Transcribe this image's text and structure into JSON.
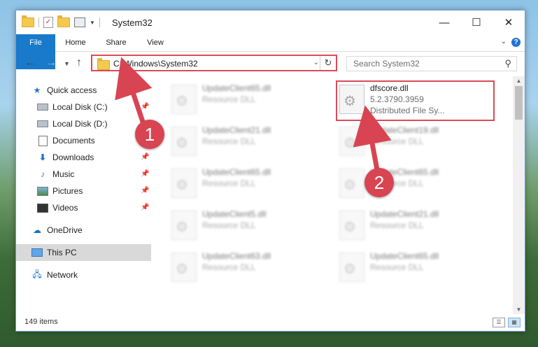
{
  "window": {
    "title": "System32",
    "controls": {
      "minimize": "—",
      "maximize": "☐",
      "close": "✕"
    }
  },
  "ribbon": {
    "tabs": [
      "File",
      "Home",
      "Share",
      "View"
    ],
    "help": "?"
  },
  "navigation": {
    "address": "C:\\Windows\\System32",
    "search_placeholder": "Search System32"
  },
  "sidebar": {
    "items": [
      {
        "label": "Quick access",
        "icon": "star-icon"
      },
      {
        "label": "Local Disk (C:)",
        "icon": "drive-icon",
        "pinned": true
      },
      {
        "label": "Local Disk (D:)",
        "icon": "drive-icon"
      },
      {
        "label": "Documents",
        "icon": "documents-icon",
        "pinned": true
      },
      {
        "label": "Downloads",
        "icon": "download-icon",
        "pinned": true
      },
      {
        "label": "Music",
        "icon": "music-icon",
        "pinned": true
      },
      {
        "label": "Pictures",
        "icon": "pictures-icon",
        "pinned": true
      },
      {
        "label": "Videos",
        "icon": "videos-icon",
        "pinned": true
      },
      {
        "label": "OneDrive",
        "icon": "cloud-icon"
      },
      {
        "label": "This PC",
        "icon": "computer-icon",
        "selected": true
      },
      {
        "label": "Network",
        "icon": "network-icon"
      }
    ]
  },
  "files": {
    "highlighted": {
      "name": "dfscore.dll",
      "version": "5.2.3790.3959",
      "description": "Distributed File Sy..."
    },
    "left_column": [
      {
        "name": "UpdateClient65.dll",
        "type": "Resource DLL"
      },
      {
        "name": "UpdateClient21.dll",
        "type": "Resource DLL"
      },
      {
        "name": "UpdateClient65.dll",
        "type": "Resource DLL"
      },
      {
        "name": "UpdateClient5.dll",
        "type": "Resource DLL"
      },
      {
        "name": "UpdateClient63.dll",
        "type": "Resource DLL"
      }
    ],
    "right_column": [
      {
        "name": "UpdateClient19.dll",
        "type": "Resource DLL"
      },
      {
        "name": "UpdateClient65.dll",
        "type": "Resource DLL"
      },
      {
        "name": "UpdateClient21.dll",
        "type": "Resource DLL"
      },
      {
        "name": "UpdateClient65.dll",
        "type": "Resource DLL"
      }
    ]
  },
  "status": {
    "item_count": "149 items"
  },
  "annotations": {
    "step1": "1",
    "step2": "2",
    "color": "#d94452"
  }
}
